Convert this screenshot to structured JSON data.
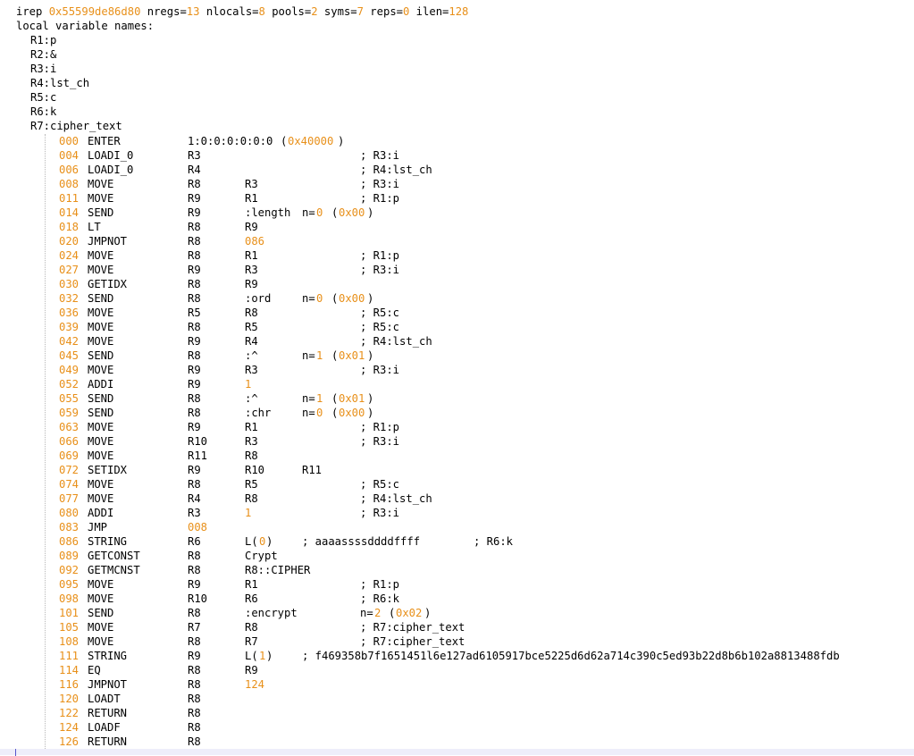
{
  "header": {
    "prefix": "irep ",
    "address": "0x55599de86d80",
    "nregs_label": " nregs=",
    "nregs": "13",
    "nlocals_label": " nlocals=",
    "nlocals": "8",
    "pools_label": " pools=",
    "pools": "2",
    "syms_label": " syms=",
    "syms": "7",
    "reps_label": " reps=",
    "reps": "0",
    "ilen_label": " ilen=",
    "ilen": "128"
  },
  "locals": {
    "title": "local variable names:",
    "items": [
      "R1:p",
      "R2:&",
      "R3:i",
      "R4:lst_ch",
      "R5:c",
      "R6:k",
      "R7:cipher_text"
    ]
  },
  "code": [
    {
      "addr": "000",
      "op": "ENTER",
      "a1": "1:0:0:0:0:0:0",
      "a1_hex": "0x40000"
    },
    {
      "addr": "004",
      "op": "LOADI_0",
      "a1": "R3",
      "comment": "; R3:i"
    },
    {
      "addr": "006",
      "op": "LOADI_0",
      "a1": "R4",
      "comment": "; R4:lst_ch"
    },
    {
      "addr": "008",
      "op": "MOVE",
      "a1": "R8",
      "a2": "R3",
      "comment": "; R3:i"
    },
    {
      "addr": "011",
      "op": "MOVE",
      "a1": "R9",
      "a2": "R1",
      "comment": "; R1:p"
    },
    {
      "addr": "014",
      "op": "SEND",
      "a1": "R9",
      "a2": ":length",
      "n_label": "n=",
      "n": "0",
      "n_hex": "0x00"
    },
    {
      "addr": "018",
      "op": "LT",
      "a1": "R8",
      "a2": "R9"
    },
    {
      "addr": "020",
      "op": "JMPNOT",
      "a1": "R8",
      "a2_num": "086"
    },
    {
      "addr": "024",
      "op": "MOVE",
      "a1": "R8",
      "a2": "R1",
      "comment": "; R1:p"
    },
    {
      "addr": "027",
      "op": "MOVE",
      "a1": "R9",
      "a2": "R3",
      "comment": "; R3:i"
    },
    {
      "addr": "030",
      "op": "GETIDX",
      "a1": "R8",
      "a2": "R9"
    },
    {
      "addr": "032",
      "op": "SEND",
      "a1": "R8",
      "a2": ":ord",
      "n_label": "n=",
      "n": "0",
      "n_hex": "0x00"
    },
    {
      "addr": "036",
      "op": "MOVE",
      "a1": "R5",
      "a2": "R8",
      "comment": "; R5:c"
    },
    {
      "addr": "039",
      "op": "MOVE",
      "a1": "R8",
      "a2": "R5",
      "comment": "; R5:c"
    },
    {
      "addr": "042",
      "op": "MOVE",
      "a1": "R9",
      "a2": "R4",
      "comment": "; R4:lst_ch"
    },
    {
      "addr": "045",
      "op": "SEND",
      "a1": "R8",
      "a2": ":^",
      "n_label": "n=",
      "n": "1",
      "n_hex": "0x01"
    },
    {
      "addr": "049",
      "op": "MOVE",
      "a1": "R9",
      "a2": "R3",
      "comment": "; R3:i"
    },
    {
      "addr": "052",
      "op": "ADDI",
      "a1": "R9",
      "a2_num": "1"
    },
    {
      "addr": "055",
      "op": "SEND",
      "a1": "R8",
      "a2": ":^",
      "n_label": "n=",
      "n": "1",
      "n_hex": "0x01"
    },
    {
      "addr": "059",
      "op": "SEND",
      "a1": "R8",
      "a2": ":chr",
      "n_label": "n=",
      "n": "0",
      "n_hex": "0x00"
    },
    {
      "addr": "063",
      "op": "MOVE",
      "a1": "R9",
      "a2": "R1",
      "comment": "; R1:p"
    },
    {
      "addr": "066",
      "op": "MOVE",
      "a1": "R10",
      "a2": "R3",
      "comment": "; R3:i"
    },
    {
      "addr": "069",
      "op": "MOVE",
      "a1": "R11",
      "a2": "R8"
    },
    {
      "addr": "072",
      "op": "SETIDX",
      "a1": "R9",
      "a2": "R10",
      "a3": "R11"
    },
    {
      "addr": "074",
      "op": "MOVE",
      "a1": "R8",
      "a2": "R5",
      "comment": "; R5:c"
    },
    {
      "addr": "077",
      "op": "MOVE",
      "a1": "R4",
      "a2": "R8",
      "comment": "; R4:lst_ch"
    },
    {
      "addr": "080",
      "op": "ADDI",
      "a1": "R3",
      "a2_num": "1",
      "comment": "; R3:i"
    },
    {
      "addr": "083",
      "op": "JMP",
      "a1_num": "008"
    },
    {
      "addr": "086",
      "op": "STRING",
      "a1": "R6",
      "lit_pre": "L(",
      "lit_num": "0",
      "lit_post": ")",
      "lit_comment": "; aaaassssddddffff",
      "comment2": "; R6:k"
    },
    {
      "addr": "089",
      "op": "GETCONST",
      "a1": "R8",
      "a2": "Crypt"
    },
    {
      "addr": "092",
      "op": "GETMCNST",
      "a1": "R8",
      "a2": "R8::CIPHER"
    },
    {
      "addr": "095",
      "op": "MOVE",
      "a1": "R9",
      "a2": "R1",
      "comment": "; R1:p"
    },
    {
      "addr": "098",
      "op": "MOVE",
      "a1": "R10",
      "a2": "R6",
      "comment": "; R6:k"
    },
    {
      "addr": "101",
      "op": "SEND",
      "a1": "R8",
      "a2": ":encrypt",
      "n_label_far": "n=",
      "n": "2",
      "n_hex": "0x02"
    },
    {
      "addr": "105",
      "op": "MOVE",
      "a1": "R7",
      "a2": "R8",
      "comment": "; R7:cipher_text"
    },
    {
      "addr": "108",
      "op": "MOVE",
      "a1": "R8",
      "a2": "R7",
      "comment": "; R7:cipher_text"
    },
    {
      "addr": "111",
      "op": "STRING",
      "a1": "R9",
      "lit_pre": "L(",
      "lit_num": "1",
      "lit_post": ")",
      "lit_comment": "; f469358b7f1651451l6e127ad6105917bce5225d6d62a714c390c5ed93b22d8b6b102a8813488fdb"
    },
    {
      "addr": "114",
      "op": "EQ",
      "a1": "R8",
      "a2": "R9"
    },
    {
      "addr": "116",
      "op": "JMPNOT",
      "a1": "R8",
      "a2_num": "124"
    },
    {
      "addr": "120",
      "op": "LOADT",
      "a1": "R8"
    },
    {
      "addr": "122",
      "op": "RETURN",
      "a1": "R8"
    },
    {
      "addr": "124",
      "op": "LOADF",
      "a1": "R8"
    },
    {
      "addr": "126",
      "op": "RETURN",
      "a1": "R8"
    }
  ]
}
